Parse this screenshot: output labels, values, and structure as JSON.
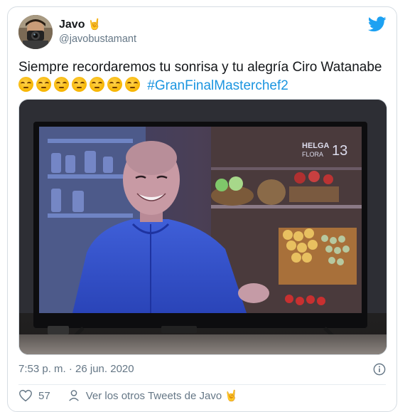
{
  "tweet": {
    "author": {
      "display_name": "Javo",
      "name_emoji": "🤘",
      "handle": "@javobustamant"
    },
    "text": "Siempre recordaremos tu sonrisa y tu alegría Ciro Watanabe",
    "emoji_count": 7,
    "hashtag": "#GranFinalMasterchef2",
    "timestamp": "7:53 p. m. · 26 jun. 2020",
    "like_count": "57",
    "see_more_label": "Ver los otros Tweets de Javo",
    "see_more_emoji": "🤘"
  },
  "icons": {
    "brand": "twitter-bird-icon",
    "info": "info-icon",
    "like": "heart-icon",
    "profile": "person-icon"
  },
  "colors": {
    "brand": "#1da1f2",
    "hashtag": "#1b95e0",
    "text": "#14171a",
    "secondary": "#657786"
  }
}
